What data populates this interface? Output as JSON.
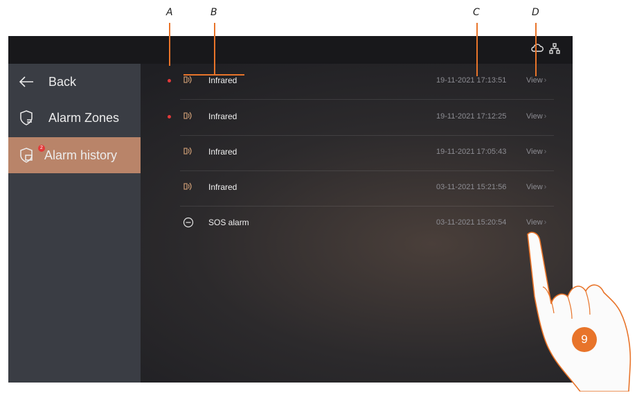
{
  "callouts": {
    "a": "A",
    "b": "B",
    "c": "C",
    "d": "D",
    "step": "9"
  },
  "sidebar": {
    "back_label": "Back",
    "items": [
      {
        "label": "Alarm Zones",
        "icon": "shield-zones-icon"
      },
      {
        "label": "Alarm history",
        "icon": "shield-history-icon",
        "badge": "2",
        "active": true
      }
    ]
  },
  "alarms": [
    {
      "type": "Infrared",
      "time": "19-11-2021 17:13:51",
      "action": "View",
      "unread": true,
      "icon": "infrared-sensor-icon"
    },
    {
      "type": "Infrared",
      "time": "19-11-2021 17:12:25",
      "action": "View",
      "unread": true,
      "icon": "infrared-sensor-icon"
    },
    {
      "type": "Infrared",
      "time": "19-11-2021 17:05:43",
      "action": "View",
      "unread": false,
      "icon": "infrared-sensor-icon"
    },
    {
      "type": "Infrared",
      "time": "03-11-2021 15:21:56",
      "action": "View",
      "unread": false,
      "icon": "infrared-sensor-icon"
    },
    {
      "type": "SOS alarm",
      "time": "03-11-2021 15:20:54",
      "action": "View",
      "unread": false,
      "icon": "sos-icon"
    }
  ],
  "colors": {
    "accent": "#e8742a",
    "active": "#b98469",
    "unread_dot": "#e23a3a"
  }
}
